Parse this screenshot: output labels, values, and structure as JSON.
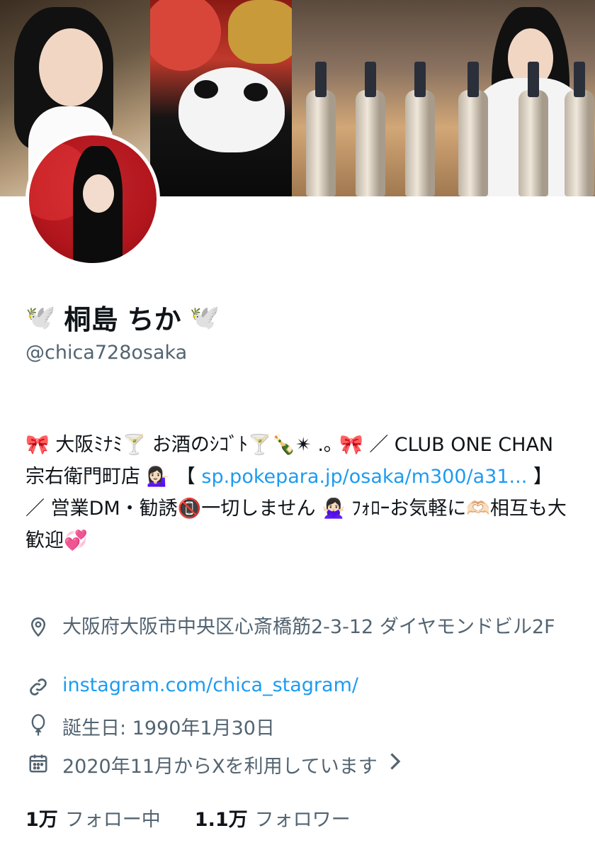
{
  "profile": {
    "name": "桐島 ちか",
    "name_emoji": "🕊️",
    "handle": "@chica728osaka"
  },
  "bio": {
    "parts": [
      "🎀 大阪ﾐﾅﾐ🍸 お酒のｼｺﾞﾄ🍸🍾✴︎ .｡ 🎀 ／ CLUB ONE CHAN 宗右衛門町店 💁🏻‍♀️ 【",
      "sp.pokepara.jp/osaka/m300/a31...",
      "】／ 営業DM・勧誘📵一切しません 🙅🏻‍♀️ ﾌｫﾛｰお気軽に🫶🏻相互も大歓迎💞"
    ]
  },
  "meta": {
    "location": "大阪府大阪市中央区心斎橋筋2-3-12 ダイヤモンドビル2F",
    "website": "instagram.com/chica_stagram/",
    "birthday": "誕生日: 1990年1月30日",
    "joined": "2020年11月からXを利用しています",
    "icons": [
      "location-icon",
      "link-icon",
      "balloon-icon",
      "calendar-icon",
      "chevron-right-icon"
    ]
  },
  "stats": {
    "following_count": "1万",
    "following_label": "フォロー中",
    "followers_count": "1.1万",
    "followers_label": "フォロワー"
  },
  "colors": {
    "link": "#1d9bf0",
    "secondary_text": "#536471",
    "primary_text": "#0f1419"
  }
}
